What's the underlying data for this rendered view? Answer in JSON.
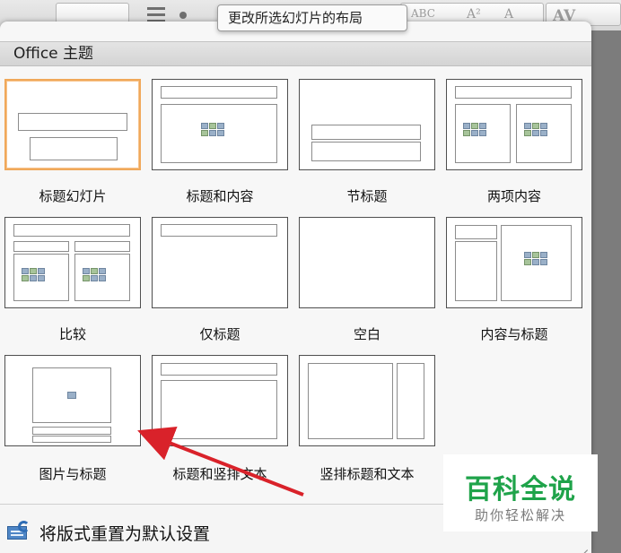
{
  "tooltip": {
    "text": "更改所选幻灯片的布局"
  },
  "ribbon": {
    "glyphs": [
      "ABC",
      "A²",
      "A",
      "AV"
    ]
  },
  "gallery": {
    "header": "Office 主题",
    "layouts": [
      {
        "label": "标题幻灯片"
      },
      {
        "label": "标题和内容"
      },
      {
        "label": "节标题"
      },
      {
        "label": "两项内容"
      },
      {
        "label": "比较"
      },
      {
        "label": "仅标题"
      },
      {
        "label": "空白"
      },
      {
        "label": "内容与标题"
      },
      {
        "label": "图片与标题"
      },
      {
        "label": "标题和竖排文本"
      },
      {
        "label": "竖排标题和文本"
      }
    ],
    "selected_layout": "标题幻灯片",
    "reset": {
      "label": "将版式重置为默认设置"
    }
  },
  "watermark": {
    "title": "百科全说",
    "subtitle": "助你轻松解决"
  },
  "colors": {
    "selection": "#f0a85a",
    "arrow": "#d9222a",
    "watermark": "#1fa34a"
  }
}
